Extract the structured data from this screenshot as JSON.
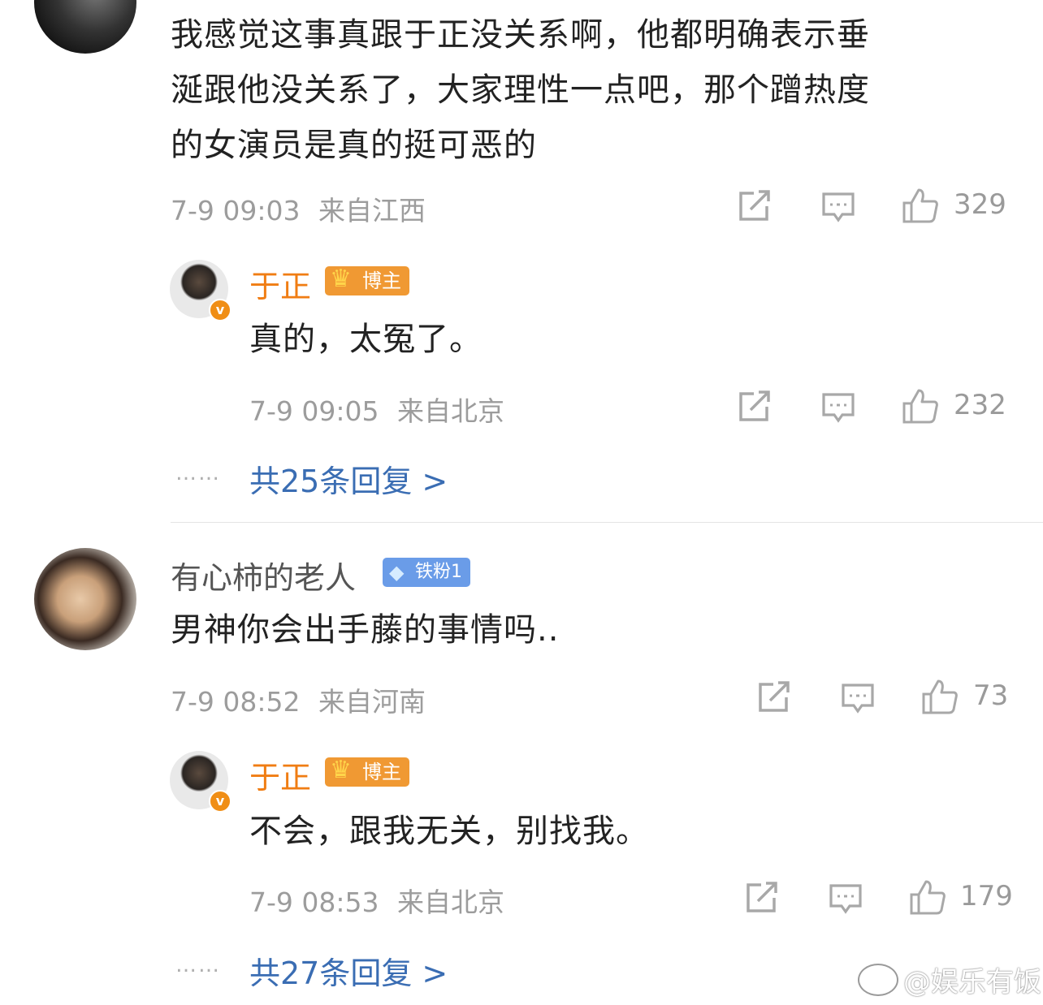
{
  "comments": [
    {
      "text_lines": [
        "我感觉这事真跟于正没关系啊，他都明确表示垂",
        "涎跟他没关系了，大家理性一点吧，那个蹭热度",
        "的女演员是真的挺可恶的"
      ],
      "time": "7-9 09:03",
      "location": "来自江西",
      "likes": "329",
      "reply": {
        "username": "于正",
        "badge": "博主",
        "text": "真的，太冤了。",
        "time": "7-9 09:05",
        "location": "来自北京",
        "likes": "232"
      },
      "more": {
        "dots": "……",
        "label": "共25条回复 >"
      }
    },
    {
      "username": "有心柿的老人",
      "badge": "铁粉1",
      "text": "男神你会出手藤的事情吗..",
      "time": "7-9 08:52",
      "location": "来自河南",
      "likes": "73",
      "reply": {
        "username": "于正",
        "badge": "博主",
        "text": "不会，跟我无关，别找我。",
        "time": "7-9 08:53",
        "location": "来自北京",
        "likes": "179"
      },
      "more": {
        "dots": "……",
        "label": "共27条回复 >"
      }
    }
  ],
  "watermark": "@娱乐有饭",
  "colors": {
    "author": "#f07d13",
    "link": "#3a6db3",
    "meta": "#9c9c9c"
  }
}
